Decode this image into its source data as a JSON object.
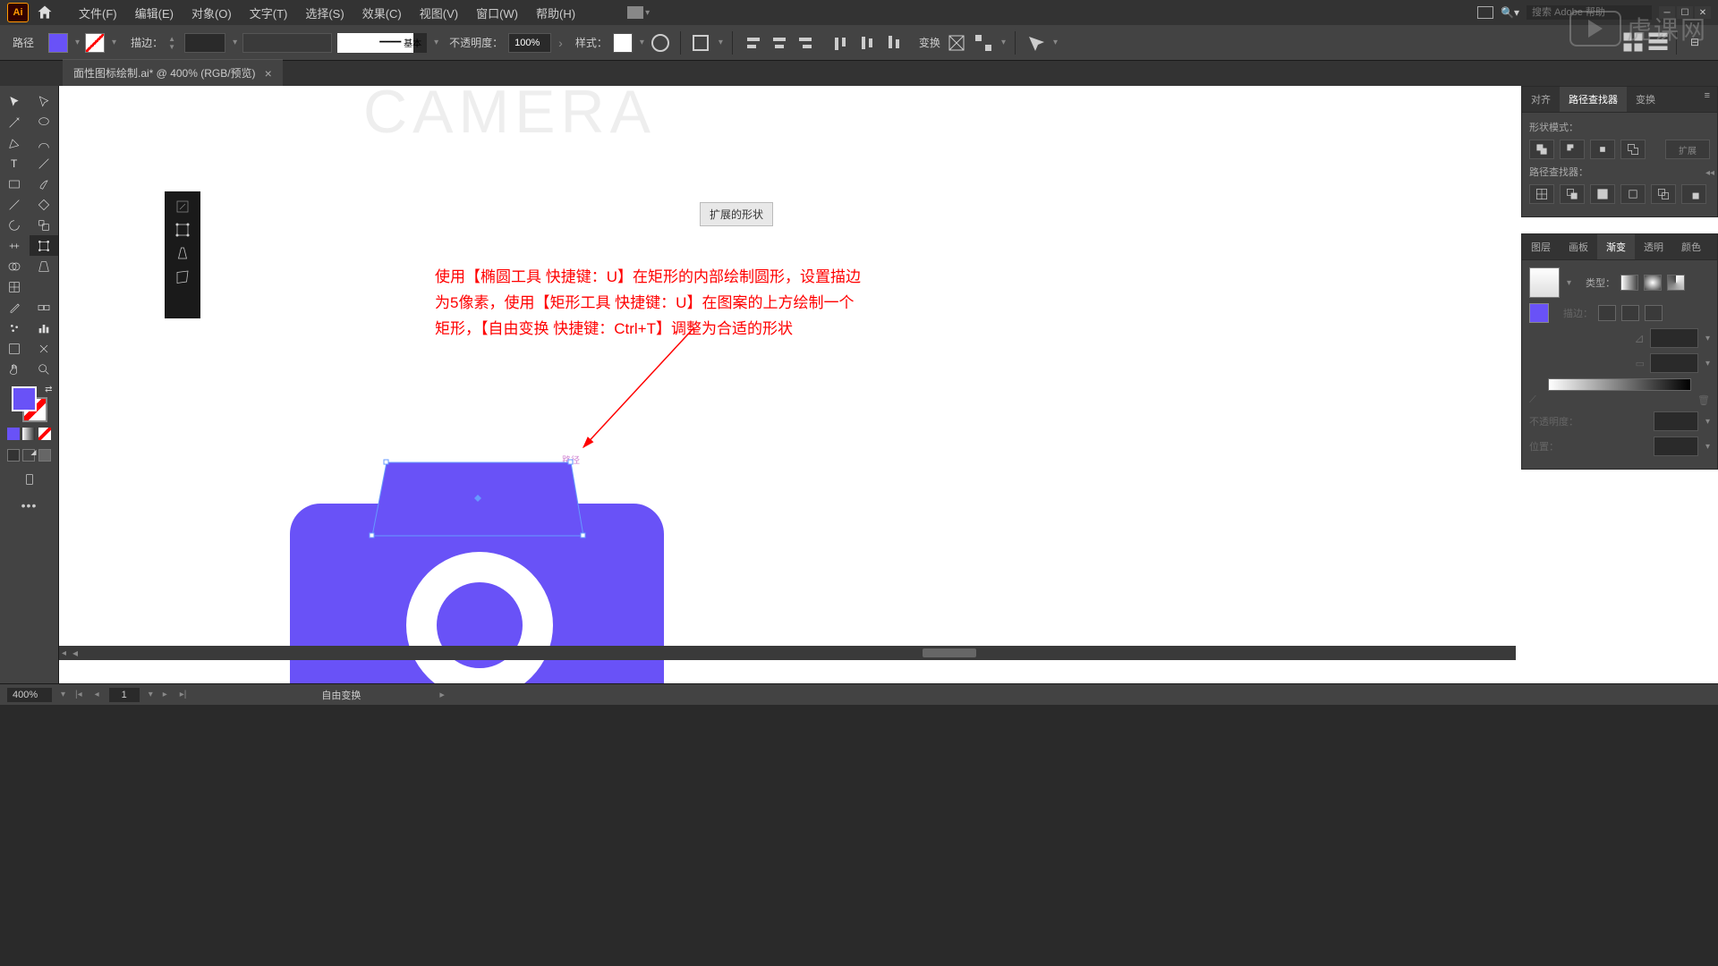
{
  "menu": {
    "file": "文件(F)",
    "edit": "编辑(E)",
    "object": "对象(O)",
    "text": "文字(T)",
    "select": "选择(S)",
    "effect": "效果(C)",
    "view": "视图(V)",
    "window": "窗口(W)",
    "help": "帮助(H)"
  },
  "search": {
    "placeholder": "搜索 Adobe 帮助"
  },
  "control": {
    "label": "路径",
    "stroke": "描边：",
    "stroke_preset": "基本",
    "opacity_label": "不透明度：",
    "opacity": "100%",
    "style_label": "样式：",
    "transform_label": "变换"
  },
  "tab": {
    "title": "面性图标绘制.ai* @ 400% (RGB/预览)"
  },
  "canvas": {
    "header": "CAMERA",
    "expand_btn": "扩展的形状",
    "path_label": "路径",
    "tutorial_line1": "使用【椭圆工具 快捷键：U】在矩形的内部绘制圆形，设置描边",
    "tutorial_line2": "为5像素，使用【矩形工具 快捷键：U】在图案的上方绘制一个",
    "tutorial_line3": "矩形，【自由变换 快捷键：Ctrl+T】调整为合适的形状"
  },
  "panels": {
    "align": {
      "tab1": "对齐",
      "tab2": "路径查找器",
      "tab3": "变换",
      "mode_label": "形状模式：",
      "pf_label": "路径查找器：",
      "expand_label": "扩展"
    },
    "gradient": {
      "tab1": "图层",
      "tab2": "画板",
      "tab3": "渐变",
      "tab4": "透明",
      "tab5": "颜色",
      "type_label": "类型：",
      "stroke_label": "描边：",
      "opacity_label": "不透明度：",
      "location_label": "位置："
    }
  },
  "status": {
    "zoom": "400%",
    "page": "1",
    "tool": "自由变换"
  },
  "colors": {
    "fill": "#6952f7",
    "accent": "#ff0000"
  }
}
